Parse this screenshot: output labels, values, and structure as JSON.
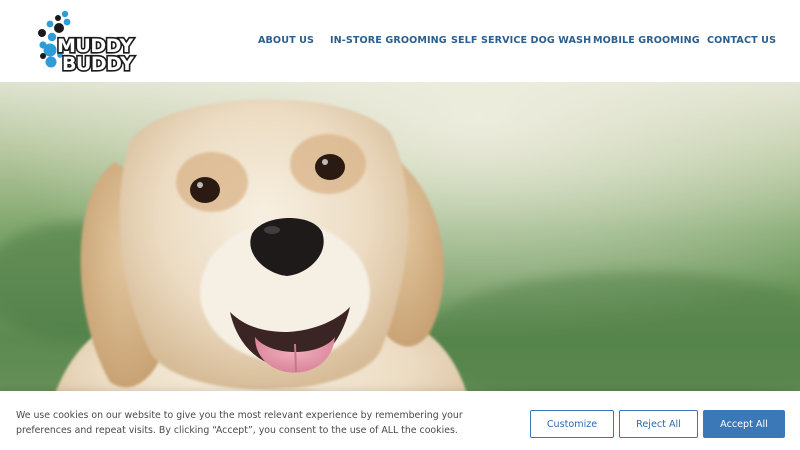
{
  "brand": {
    "logo_line1": "MUDDY",
    "logo_line2": "BUDDY",
    "colors": {
      "blue": "#2f9bd9",
      "dark": "#1a1a1a"
    }
  },
  "nav": {
    "items": [
      {
        "label": "ABOUT US"
      },
      {
        "label": "IN-STORE GROOMING"
      },
      {
        "label": "SELF SERVICE DOG WASH"
      },
      {
        "label": "MOBILE GROOMING"
      },
      {
        "label": "CONTACT US"
      }
    ],
    "color": "#2a5f8f"
  },
  "hero": {
    "subject": "golden retriever"
  },
  "cookie_banner": {
    "text": "We use cookies on our website to give you the most relevant experience by remembering your preferences and repeat visits. By clicking “Accept”, you consent to the use of ALL the cookies.",
    "customize_label": "Customize",
    "reject_label": "Reject All",
    "accept_label": "Accept All",
    "accent_color": "#3b78b8"
  }
}
